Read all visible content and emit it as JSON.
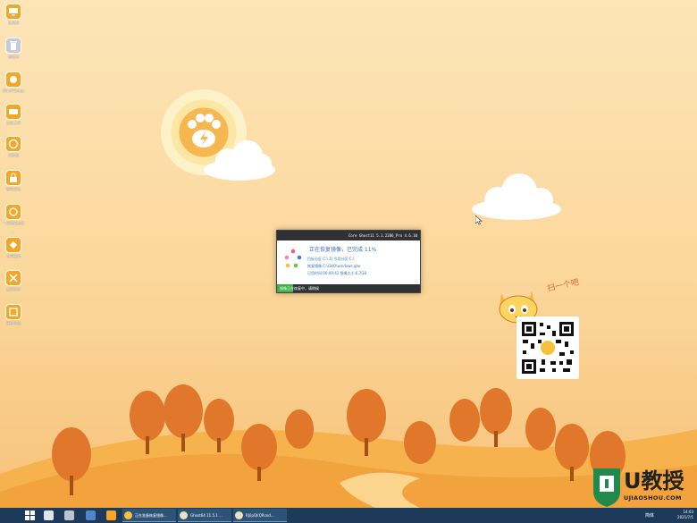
{
  "desktop": {
    "icons": [
      {
        "label": "此电脑",
        "icon": "computer-icon"
      },
      {
        "label": "回收站",
        "icon": "recycle-bin-icon"
      },
      {
        "label": "WinNTSetup",
        "icon": "setup-icon"
      },
      {
        "label": "分区工具",
        "icon": "disk-icon"
      },
      {
        "label": "浏览器",
        "icon": "globe-icon"
      },
      {
        "label": "密码清除",
        "icon": "lock-icon"
      },
      {
        "label": "一键恢复系统",
        "icon": "restore-icon"
      },
      {
        "label": "引导修复",
        "icon": "repair-icon"
      },
      {
        "label": "系统维护",
        "icon": "tools-icon"
      },
      {
        "label": "硬件检测",
        "icon": "hardware-icon"
      }
    ]
  },
  "ghost": {
    "titlebar": "Core Ghost11 5.1.2286_Pro 4.6.10",
    "heading": "正在恢复镜像，已完成 11%",
    "line1": "目标分区:C:\\ 1) 引导分区:C:\\",
    "line2": "恢复镜像:C:\\GHO\\windows.gho",
    "line3": "已用时间:00:00:42    镜像大小:6.7GB",
    "status": "镜像正在恢复中，请稍候",
    "progress": 0.11
  },
  "qr": {
    "caption": "扫一个吧"
  },
  "taskbar": {
    "tasks": [
      {
        "label": "正在准备恢复镜像..."
      },
      {
        "label": "Ghost64 11.5.1 ..."
      },
      {
        "label": "RJ/ipQl(QRcod..."
      }
    ],
    "tray_text": "简体",
    "time": "14:03",
    "date": "2021/7/1"
  },
  "watermark": {
    "brand": "U教授",
    "url": "UJIAOSHOU.COM"
  },
  "colors": {
    "accent": "#f5a623",
    "progress": "#3fb04a",
    "taskbar": "#1e3a5a"
  }
}
